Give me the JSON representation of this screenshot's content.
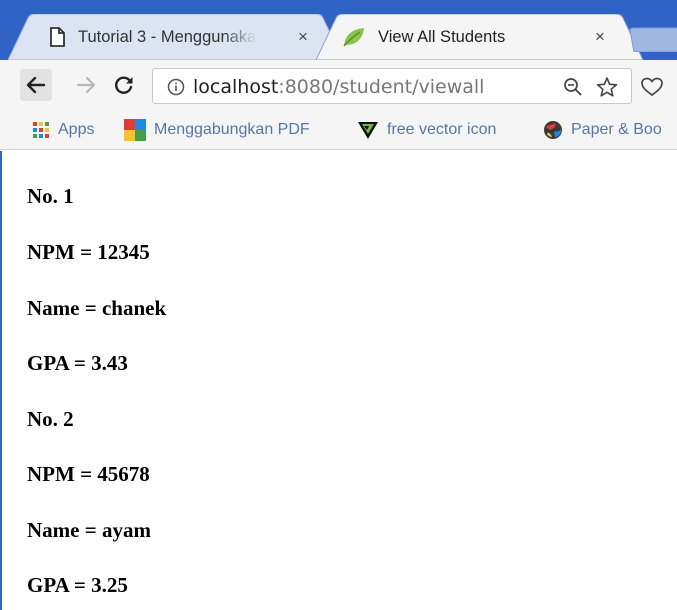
{
  "tabs": [
    {
      "title": "Tutorial 3 - Menggunaka",
      "close": "×",
      "active": false,
      "icon": "document-icon"
    },
    {
      "title": "View All Students",
      "close": "×",
      "active": true,
      "icon": "spring-leaf-icon"
    }
  ],
  "toolbar": {
    "url_host": "localhost",
    "url_path": ":8080/student/viewall",
    "icons": [
      "back-arrow-icon",
      "forward-arrow-icon",
      "reload-icon",
      "info-icon",
      "zoom-out-icon",
      "star-icon",
      "heart-icon"
    ]
  },
  "bookmarks": [
    {
      "label": "Apps",
      "icon": "apps-grid-icon"
    },
    {
      "label": "Menggabungkan PDF",
      "icon": "colorful-squares-icon"
    },
    {
      "label": "free vector icon",
      "icon": "vector-v-icon"
    },
    {
      "label": "Paper & Boo",
      "icon": "globe-ball-icon"
    }
  ],
  "students": [
    {
      "no": "No. 1",
      "npm": "NPM = 12345",
      "name": "Name = chanek",
      "gpa": "GPA = 3.43"
    },
    {
      "no": "No. 2",
      "npm": "NPM = 45678",
      "name": "Name = ayam",
      "gpa": "GPA = 3.25"
    }
  ],
  "colors": {
    "frame": "#2f63c6",
    "tab_bg": "#f5f5f5",
    "link": "#5577a8"
  }
}
